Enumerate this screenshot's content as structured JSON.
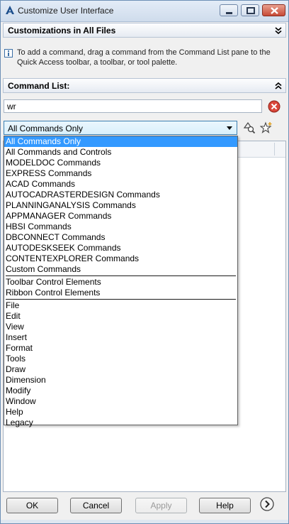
{
  "window": {
    "title": "Customize User Interface"
  },
  "customizations": {
    "header": "Customizations in All Files"
  },
  "info": {
    "text": "To add a command, drag a command from the Command List pane to the Quick Access toolbar, a toolbar, or tool palette."
  },
  "command_list": {
    "header": "Command List:",
    "search_value": "wr",
    "filter_selected": "All Commands Only"
  },
  "dropdown": {
    "group1": [
      "All Commands Only",
      "All Commands and Controls",
      "MODELDOC Commands",
      "EXPRESS Commands",
      "ACAD Commands",
      "AUTOCADRASTERDESIGN Commands",
      "PLANNINGANALYSIS Commands",
      "APPMANAGER Commands",
      "HBSI Commands",
      "DBCONNECT Commands",
      "AUTODESKSEEK Commands",
      "CONTENTEXPLORER Commands",
      "Custom Commands"
    ],
    "group2": [
      "Toolbar Control Elements",
      "Ribbon Control Elements"
    ],
    "group3": [
      "File",
      "Edit",
      "View",
      "Insert",
      "Format",
      "Tools",
      "Draw",
      "Dimension",
      "Modify",
      "Window",
      "Help",
      "Legacy"
    ]
  },
  "buttons": {
    "ok": "OK",
    "cancel": "Cancel",
    "apply": "Apply",
    "help": "Help"
  },
  "colors": {
    "selection": "#3399ff",
    "title_bg": "#cfdcec",
    "close": "#c74a36"
  }
}
